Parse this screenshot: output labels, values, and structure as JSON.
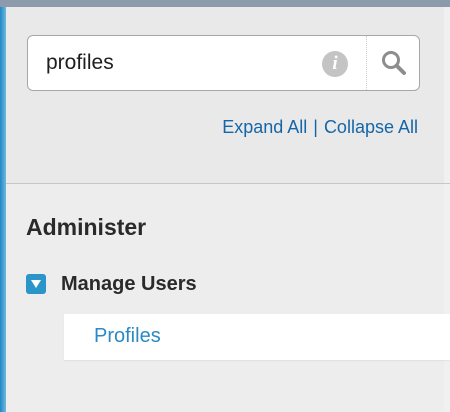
{
  "search": {
    "value": "profiles",
    "info_icon": "info-icon",
    "search_icon": "magnifier-icon"
  },
  "links": {
    "expand_all": "Expand All",
    "separator": "|",
    "collapse_all": "Collapse All"
  },
  "nav": {
    "section_title": "Administer",
    "group": {
      "label": "Manage Users",
      "expanded": true,
      "toggle_icon": "collapse-triangle-icon",
      "children": [
        {
          "label": "Profiles"
        }
      ]
    }
  },
  "colors": {
    "accent": "#2a95c9",
    "link": "#1566a8",
    "child_link": "#2b8ac4"
  }
}
